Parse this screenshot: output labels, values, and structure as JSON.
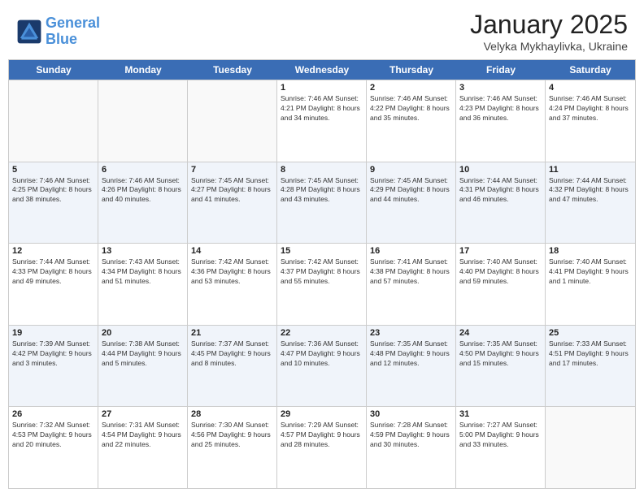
{
  "header": {
    "logo_line1": "General",
    "logo_line2": "Blue",
    "month": "January 2025",
    "location": "Velyka Mykhaylivka, Ukraine"
  },
  "weekdays": [
    "Sunday",
    "Monday",
    "Tuesday",
    "Wednesday",
    "Thursday",
    "Friday",
    "Saturday"
  ],
  "weeks": [
    [
      {
        "day": "",
        "info": ""
      },
      {
        "day": "",
        "info": ""
      },
      {
        "day": "",
        "info": ""
      },
      {
        "day": "1",
        "info": "Sunrise: 7:46 AM\nSunset: 4:21 PM\nDaylight: 8 hours\nand 34 minutes."
      },
      {
        "day": "2",
        "info": "Sunrise: 7:46 AM\nSunset: 4:22 PM\nDaylight: 8 hours\nand 35 minutes."
      },
      {
        "day": "3",
        "info": "Sunrise: 7:46 AM\nSunset: 4:23 PM\nDaylight: 8 hours\nand 36 minutes."
      },
      {
        "day": "4",
        "info": "Sunrise: 7:46 AM\nSunset: 4:24 PM\nDaylight: 8 hours\nand 37 minutes."
      }
    ],
    [
      {
        "day": "5",
        "info": "Sunrise: 7:46 AM\nSunset: 4:25 PM\nDaylight: 8 hours\nand 38 minutes."
      },
      {
        "day": "6",
        "info": "Sunrise: 7:46 AM\nSunset: 4:26 PM\nDaylight: 8 hours\nand 40 minutes."
      },
      {
        "day": "7",
        "info": "Sunrise: 7:45 AM\nSunset: 4:27 PM\nDaylight: 8 hours\nand 41 minutes."
      },
      {
        "day": "8",
        "info": "Sunrise: 7:45 AM\nSunset: 4:28 PM\nDaylight: 8 hours\nand 43 minutes."
      },
      {
        "day": "9",
        "info": "Sunrise: 7:45 AM\nSunset: 4:29 PM\nDaylight: 8 hours\nand 44 minutes."
      },
      {
        "day": "10",
        "info": "Sunrise: 7:44 AM\nSunset: 4:31 PM\nDaylight: 8 hours\nand 46 minutes."
      },
      {
        "day": "11",
        "info": "Sunrise: 7:44 AM\nSunset: 4:32 PM\nDaylight: 8 hours\nand 47 minutes."
      }
    ],
    [
      {
        "day": "12",
        "info": "Sunrise: 7:44 AM\nSunset: 4:33 PM\nDaylight: 8 hours\nand 49 minutes."
      },
      {
        "day": "13",
        "info": "Sunrise: 7:43 AM\nSunset: 4:34 PM\nDaylight: 8 hours\nand 51 minutes."
      },
      {
        "day": "14",
        "info": "Sunrise: 7:42 AM\nSunset: 4:36 PM\nDaylight: 8 hours\nand 53 minutes."
      },
      {
        "day": "15",
        "info": "Sunrise: 7:42 AM\nSunset: 4:37 PM\nDaylight: 8 hours\nand 55 minutes."
      },
      {
        "day": "16",
        "info": "Sunrise: 7:41 AM\nSunset: 4:38 PM\nDaylight: 8 hours\nand 57 minutes."
      },
      {
        "day": "17",
        "info": "Sunrise: 7:40 AM\nSunset: 4:40 PM\nDaylight: 8 hours\nand 59 minutes."
      },
      {
        "day": "18",
        "info": "Sunrise: 7:40 AM\nSunset: 4:41 PM\nDaylight: 9 hours\nand 1 minute."
      }
    ],
    [
      {
        "day": "19",
        "info": "Sunrise: 7:39 AM\nSunset: 4:42 PM\nDaylight: 9 hours\nand 3 minutes."
      },
      {
        "day": "20",
        "info": "Sunrise: 7:38 AM\nSunset: 4:44 PM\nDaylight: 9 hours\nand 5 minutes."
      },
      {
        "day": "21",
        "info": "Sunrise: 7:37 AM\nSunset: 4:45 PM\nDaylight: 9 hours\nand 8 minutes."
      },
      {
        "day": "22",
        "info": "Sunrise: 7:36 AM\nSunset: 4:47 PM\nDaylight: 9 hours\nand 10 minutes."
      },
      {
        "day": "23",
        "info": "Sunrise: 7:35 AM\nSunset: 4:48 PM\nDaylight: 9 hours\nand 12 minutes."
      },
      {
        "day": "24",
        "info": "Sunrise: 7:35 AM\nSunset: 4:50 PM\nDaylight: 9 hours\nand 15 minutes."
      },
      {
        "day": "25",
        "info": "Sunrise: 7:33 AM\nSunset: 4:51 PM\nDaylight: 9 hours\nand 17 minutes."
      }
    ],
    [
      {
        "day": "26",
        "info": "Sunrise: 7:32 AM\nSunset: 4:53 PM\nDaylight: 9 hours\nand 20 minutes."
      },
      {
        "day": "27",
        "info": "Sunrise: 7:31 AM\nSunset: 4:54 PM\nDaylight: 9 hours\nand 22 minutes."
      },
      {
        "day": "28",
        "info": "Sunrise: 7:30 AM\nSunset: 4:56 PM\nDaylight: 9 hours\nand 25 minutes."
      },
      {
        "day": "29",
        "info": "Sunrise: 7:29 AM\nSunset: 4:57 PM\nDaylight: 9 hours\nand 28 minutes."
      },
      {
        "day": "30",
        "info": "Sunrise: 7:28 AM\nSunset: 4:59 PM\nDaylight: 9 hours\nand 30 minutes."
      },
      {
        "day": "31",
        "info": "Sunrise: 7:27 AM\nSunset: 5:00 PM\nDaylight: 9 hours\nand 33 minutes."
      },
      {
        "day": "",
        "info": ""
      }
    ]
  ]
}
